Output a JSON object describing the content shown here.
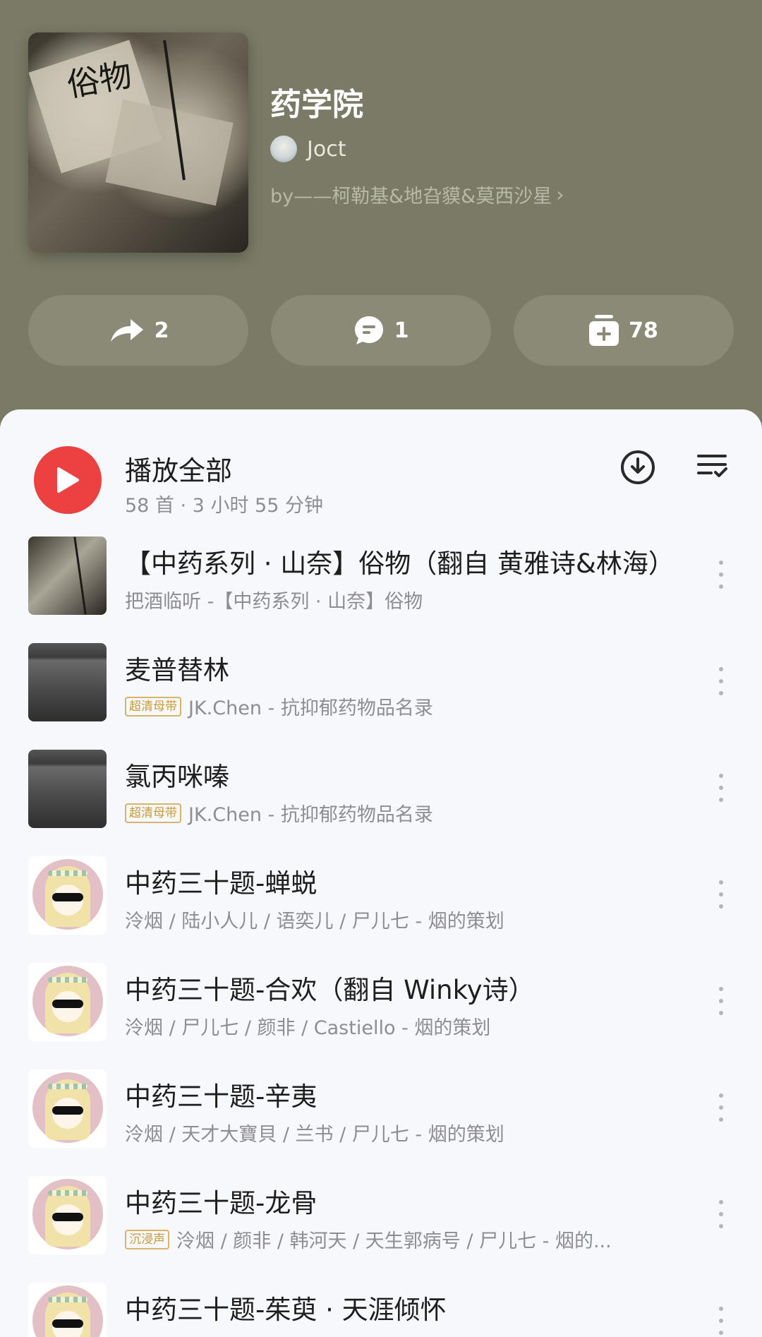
{
  "playlist": {
    "title": "药学院",
    "creator": "Joct",
    "description": "by——柯勒基&地旮貘&莫西沙星",
    "cover_text": "俗物",
    "actions": {
      "share_count": "2",
      "comment_count": "1",
      "collect_count": "78"
    }
  },
  "play_all": {
    "label": "播放全部",
    "summary": "58 首 · 3 小时 55 分钟"
  },
  "songs": [
    {
      "title": "【中药系列 · 山奈】俗物（翻自 黄雅诗&林海）",
      "tag": "",
      "subtitle": "把酒临听 -【中药系列 · 山奈】俗物"
    },
    {
      "title": "麦普替林",
      "tag": "超清母带",
      "subtitle": "JK.Chen - 抗抑郁药物品名录"
    },
    {
      "title": "氯丙咪嗪",
      "tag": "超清母带",
      "subtitle": "JK.Chen - 抗抑郁药物品名录"
    },
    {
      "title": "中药三十题-蝉蜕",
      "tag": "",
      "subtitle": "泠烟 / 陆小人儿 / 语奕儿 / 尸儿七 - 烟的策划"
    },
    {
      "title": "中药三十题-合欢（翻自 Winky诗）",
      "tag": "",
      "subtitle": "泠烟 / 尸儿七 / 颜非 / Castiello - 烟的策划"
    },
    {
      "title": "中药三十题-辛夷",
      "tag": "",
      "subtitle": "泠烟 / 天才大寶貝 / 兰书 / 尸儿七 - 烟的策划"
    },
    {
      "title": "中药三十题-龙骨",
      "tag": "沉浸声",
      "subtitle": "泠烟 / 颜非 / 韩河天 / 天生郭病号 / 尸儿七 - 烟的..."
    },
    {
      "title": "中药三十题-茱萸 · 天涯倾怀",
      "tag": "",
      "subtitle": ""
    }
  ],
  "colors": {
    "header_bg": "#7a7a66",
    "accent": "#ec4141",
    "sheet_bg": "#f7f8fc"
  },
  "icons": {
    "share": "share-arrow-icon",
    "comment": "comment-bubble-icon",
    "collect": "collect-plus-icon",
    "play": "play-icon",
    "download": "download-icon",
    "multi_select": "multi-select-icon",
    "more": "more-vertical-icon"
  }
}
